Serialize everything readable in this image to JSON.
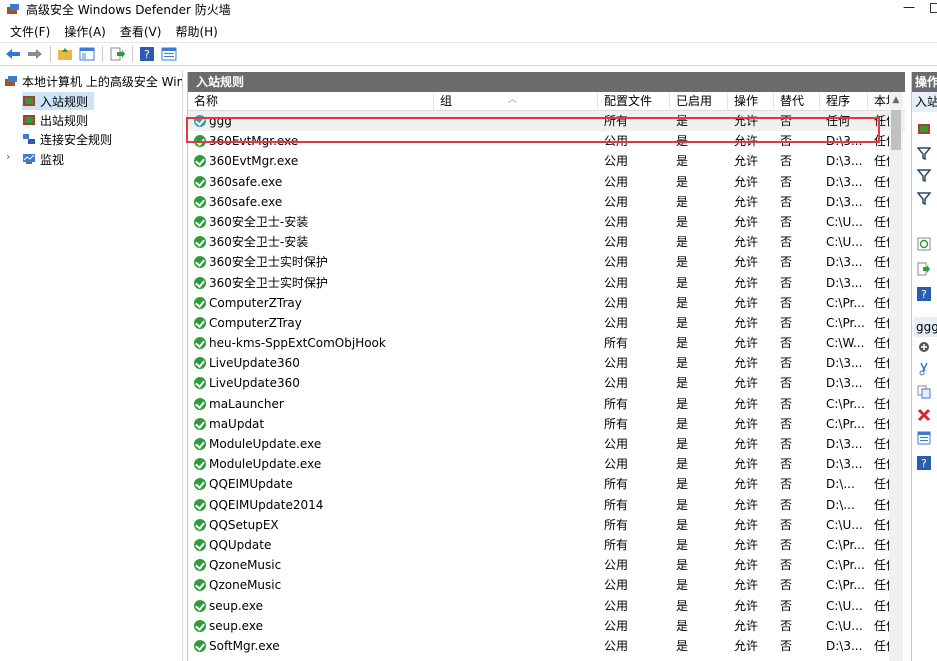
{
  "window": {
    "title": "高级安全 Windows Defender 防火墙",
    "minimize_glyph": "—"
  },
  "menu": [
    "文件(F)",
    "操作(A)",
    "查看(V)",
    "帮助(H)"
  ],
  "toolbar": [
    "back-arrow-icon",
    "forward-arrow-icon",
    "folder-up-icon",
    "show-hide-tree-icon",
    "export-icon",
    "help-icon",
    "properties-icon"
  ],
  "tree": {
    "root": "本地计算机 上的高级安全 Windows Defender",
    "items": [
      "入站规则",
      "出站规则",
      "连接安全规则",
      "监视"
    ]
  },
  "main": {
    "header": "入站规则",
    "columns": [
      "名称",
      "组",
      "配置文件",
      "已启用",
      "操作",
      "替代",
      "程序",
      "本地地址"
    ],
    "rows": [
      [
        "ggg",
        "",
        "所有",
        "是",
        "允许",
        "否",
        "任何",
        "任何"
      ],
      [
        "360EvtMgr.exe",
        "",
        "公用",
        "是",
        "允许",
        "否",
        "D:\\3...",
        "任何"
      ],
      [
        "360EvtMgr.exe",
        "",
        "公用",
        "是",
        "允许",
        "否",
        "D:\\3...",
        "任何"
      ],
      [
        "360safe.exe",
        "",
        "公用",
        "是",
        "允许",
        "否",
        "D:\\3...",
        "任何"
      ],
      [
        "360safe.exe",
        "",
        "公用",
        "是",
        "允许",
        "否",
        "D:\\3...",
        "任何"
      ],
      [
        "360安全卫士-安装",
        "",
        "公用",
        "是",
        "允许",
        "否",
        "C:\\U...",
        "任何"
      ],
      [
        "360安全卫士-安装",
        "",
        "公用",
        "是",
        "允许",
        "否",
        "C:\\U...",
        "任何"
      ],
      [
        "360安全卫士实时保护",
        "",
        "公用",
        "是",
        "允许",
        "否",
        "D:\\3...",
        "任何"
      ],
      [
        "360安全卫士实时保护",
        "",
        "公用",
        "是",
        "允许",
        "否",
        "D:\\3...",
        "任何"
      ],
      [
        "ComputerZTray",
        "",
        "公用",
        "是",
        "允许",
        "否",
        "C:\\Pr...",
        "任何"
      ],
      [
        "ComputerZTray",
        "",
        "公用",
        "是",
        "允许",
        "否",
        "C:\\Pr...",
        "任何"
      ],
      [
        "heu-kms-SppExtComObjHook",
        "",
        "所有",
        "是",
        "允许",
        "否",
        "C:\\W...",
        "任何"
      ],
      [
        "LiveUpdate360",
        "",
        "公用",
        "是",
        "允许",
        "否",
        "D:\\3...",
        "任何"
      ],
      [
        "LiveUpdate360",
        "",
        "公用",
        "是",
        "允许",
        "否",
        "D:\\3...",
        "任何"
      ],
      [
        "maLauncher",
        "",
        "所有",
        "是",
        "允许",
        "否",
        "C:\\Pr...",
        "任何"
      ],
      [
        "maUpdat",
        "",
        "所有",
        "是",
        "允许",
        "否",
        "C:\\Pr...",
        "任何"
      ],
      [
        "ModuleUpdate.exe",
        "",
        "公用",
        "是",
        "允许",
        "否",
        "D:\\3...",
        "任何"
      ],
      [
        "ModuleUpdate.exe",
        "",
        "公用",
        "是",
        "允许",
        "否",
        "D:\\3...",
        "任何"
      ],
      [
        "QQEIMUpdate",
        "",
        "所有",
        "是",
        "允许",
        "否",
        "D:\\...",
        "任何"
      ],
      [
        "QQEIMUpdate2014",
        "",
        "所有",
        "是",
        "允许",
        "否",
        "D:\\...",
        "任何"
      ],
      [
        "QQSetupEX",
        "",
        "所有",
        "是",
        "允许",
        "否",
        "C:\\U...",
        "任何"
      ],
      [
        "QQUpdate",
        "",
        "所有",
        "是",
        "允许",
        "否",
        "C:\\Pr...",
        "任何"
      ],
      [
        "QzoneMusic",
        "",
        "公用",
        "是",
        "允许",
        "否",
        "C:\\Pr...",
        "任何"
      ],
      [
        "QzoneMusic",
        "",
        "公用",
        "是",
        "允许",
        "否",
        "C:\\Pr...",
        "任何"
      ],
      [
        "seup.exe",
        "",
        "公用",
        "是",
        "允许",
        "否",
        "C:\\U...",
        "任何"
      ],
      [
        "seup.exe",
        "",
        "公用",
        "是",
        "允许",
        "否",
        "C:\\U...",
        "任何"
      ],
      [
        "SoftMgr.exe",
        "",
        "公用",
        "是",
        "允许",
        "否",
        "D:\\3...",
        "任何"
      ]
    ]
  },
  "actions": {
    "header": "操作",
    "section": "入站规则",
    "selected_label": "ggg",
    "icons": [
      "new-rule-icon",
      "filter-profile-icon",
      "filter-state-icon",
      "filter-group-icon",
      "refresh-icon",
      "export-list-icon",
      "help-icon",
      "disable-rule-icon",
      "cut-icon",
      "copy-icon",
      "delete-icon",
      "properties-icon",
      "help-icon"
    ]
  },
  "colors": {
    "header_bg": "#6b6b6b",
    "selection_bg": "#cce4f7",
    "highlight_border": "#e0393e",
    "allow_icon": "#2e9c3a"
  }
}
